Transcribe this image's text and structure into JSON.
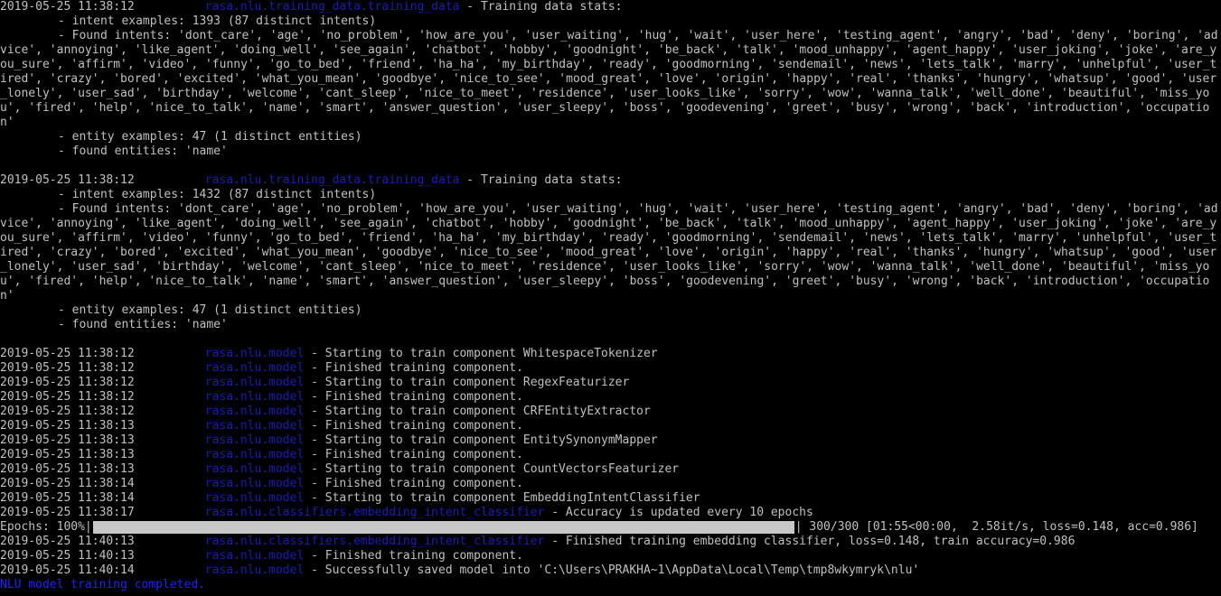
{
  "colors": {
    "background": "#000000",
    "text": "#c0c0c0",
    "module": "#1c1cb8",
    "final": "#2020ff",
    "progress_fill": "#c8c8c8"
  },
  "stats": [
    {
      "timestamp": "2019-05-25 11:38:12",
      "module": "rasa.nlu.training_data.training_data",
      "message": " - Training data stats:",
      "intent_examples": "- intent examples: 1393 (87 distinct intents)",
      "found_intents": "- Found intents: 'dont_care', 'age', 'no_problem', 'how_are_you', 'user_waiting', 'hug', 'wait', 'user_here', 'testing_agent', 'angry', 'bad', 'deny', 'boring', 'advice', 'annoying', 'like_agent', 'doing_well', 'see_again', 'chatbot', 'hobby', 'goodnight', 'be_back', 'talk', 'mood_unhappy', 'agent_happy', 'user_joking', 'joke', 'are_you_sure', 'affirm', 'video', 'funny', 'go_to_bed', 'friend', 'ha_ha', 'my_birthday', 'ready', 'goodmorning', 'sendemail', 'news', 'lets_talk', 'marry', 'unhelpful', 'user_tired', 'crazy', 'bored', 'excited', 'what_you_mean', 'goodbye', 'nice_to_see', 'mood_great', 'love', 'origin', 'happy', 'real', 'thanks', 'hungry', 'whatsup', 'good', 'user_lonely', 'user_sad', 'birthday', 'welcome', 'cant_sleep', 'nice_to_meet', 'residence', 'user_looks_like', 'sorry', 'wow', 'wanna_talk', 'well_done', 'beautiful', 'miss_you', 'fired', 'help', 'nice_to_talk', 'name', 'smart', 'answer_question', 'user_sleepy', 'boss', 'goodevening', 'greet', 'busy', 'wrong', 'back', 'introduction', 'occupation'",
      "entity_examples": "- entity examples: 47 (1 distinct entities)",
      "found_entities": "- found entities: 'name'"
    },
    {
      "timestamp": "2019-05-25 11:38:12",
      "module": "rasa.nlu.training_data.training_data",
      "message": " - Training data stats:",
      "intent_examples": "- intent examples: 1432 (87 distinct intents)",
      "found_intents": "- Found intents: 'dont_care', 'age', 'no_problem', 'how_are_you', 'user_waiting', 'hug', 'wait', 'user_here', 'testing_agent', 'angry', 'bad', 'deny', 'boring', 'advice', 'annoying', 'like_agent', 'doing_well', 'see_again', 'chatbot', 'hobby', 'goodnight', 'be_back', 'talk', 'mood_unhappy', 'agent_happy', 'user_joking', 'joke', 'are_you_sure', 'affirm', 'video', 'funny', 'go_to_bed', 'friend', 'ha_ha', 'my_birthday', 'ready', 'goodmorning', 'sendemail', 'news', 'lets_talk', 'marry', 'unhelpful', 'user_tired', 'crazy', 'bored', 'excited', 'what_you_mean', 'goodbye', 'nice_to_see', 'mood_great', 'love', 'origin', 'happy', 'real', 'thanks', 'hungry', 'whatsup', 'good', 'user_lonely', 'user_sad', 'birthday', 'welcome', 'cant_sleep', 'nice_to_meet', 'residence', 'user_looks_like', 'sorry', 'wow', 'wanna_talk', 'well_done', 'beautiful', 'miss_you', 'fired', 'help', 'nice_to_talk', 'name', 'smart', 'answer_question', 'user_sleepy', 'boss', 'goodevening', 'greet', 'busy', 'wrong', 'back', 'introduction', 'occupation'",
      "entity_examples": "- entity examples: 47 (1 distinct entities)",
      "found_entities": "- found entities: 'name'"
    }
  ],
  "log": [
    {
      "timestamp": "2019-05-25 11:38:12",
      "module": "rasa.nlu.model",
      "message": " - Starting to train component WhitespaceTokenizer"
    },
    {
      "timestamp": "2019-05-25 11:38:12",
      "module": "rasa.nlu.model",
      "message": " - Finished training component."
    },
    {
      "timestamp": "2019-05-25 11:38:12",
      "module": "rasa.nlu.model",
      "message": " - Starting to train component RegexFeaturizer"
    },
    {
      "timestamp": "2019-05-25 11:38:12",
      "module": "rasa.nlu.model",
      "message": " - Finished training component."
    },
    {
      "timestamp": "2019-05-25 11:38:12",
      "module": "rasa.nlu.model",
      "message": " - Starting to train component CRFEntityExtractor"
    },
    {
      "timestamp": "2019-05-25 11:38:13",
      "module": "rasa.nlu.model",
      "message": " - Finished training component."
    },
    {
      "timestamp": "2019-05-25 11:38:13",
      "module": "rasa.nlu.model",
      "message": " - Starting to train component EntitySynonymMapper"
    },
    {
      "timestamp": "2019-05-25 11:38:13",
      "module": "rasa.nlu.model",
      "message": " - Finished training component."
    },
    {
      "timestamp": "2019-05-25 11:38:13",
      "module": "rasa.nlu.model",
      "message": " - Starting to train component CountVectorsFeaturizer"
    },
    {
      "timestamp": "2019-05-25 11:38:14",
      "module": "rasa.nlu.model",
      "message": " - Finished training component."
    },
    {
      "timestamp": "2019-05-25 11:38:14",
      "module": "rasa.nlu.model",
      "message": " - Starting to train component EmbeddingIntentClassifier"
    },
    {
      "timestamp": "2019-05-25 11:38:17",
      "module": "rasa.nlu.classifiers.embedding_intent_classifier",
      "message": " - Accuracy is updated every 10 epochs"
    }
  ],
  "progress": {
    "label": "Epochs: 100%",
    "percent": 100,
    "stats": "300/300 [01:55<00:00,  2.58it/s, loss=0.148, acc=0.986]"
  },
  "log_after": [
    {
      "timestamp": "2019-05-25 11:40:13",
      "module": "rasa.nlu.classifiers.embedding_intent_classifier",
      "message": " - Finished training embedding classifier, loss=0.148, train accuracy=0.986"
    },
    {
      "timestamp": "2019-05-25 11:40:13",
      "module": "rasa.nlu.model",
      "message": " - Finished training component."
    },
    {
      "timestamp": "2019-05-25 11:40:14",
      "module": "rasa.nlu.model",
      "message": " - Successfully saved model into 'C:\\Users\\PRAKHA~1\\AppData\\Local\\Temp\\tmp8wkymryk\\nlu'"
    }
  ],
  "final_message": "NLU model training completed."
}
